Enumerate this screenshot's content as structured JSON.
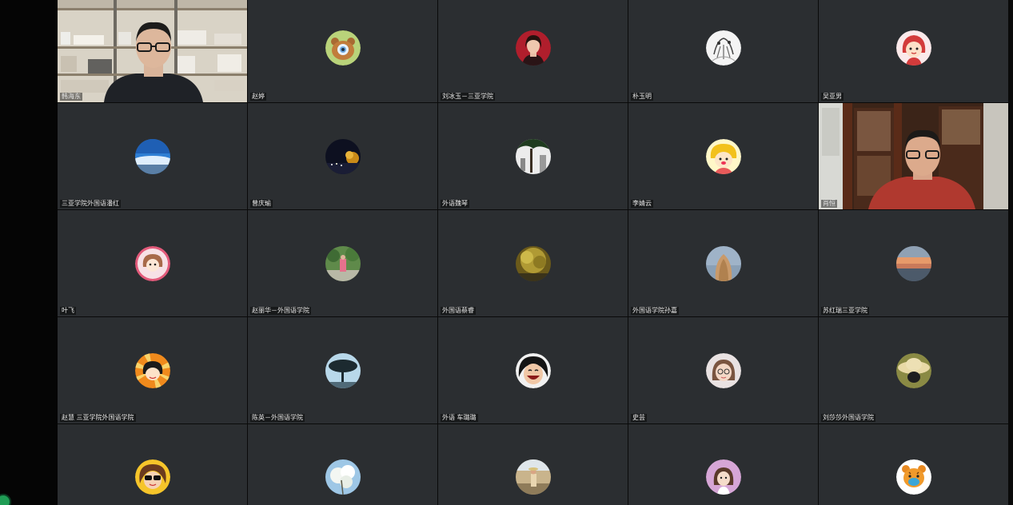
{
  "meeting": {
    "participants": [
      {
        "name": "韩海东",
        "avatar": "video-shelves"
      },
      {
        "name": "赵婷",
        "avatar": "bear-avatar"
      },
      {
        "name": "刘冰玉－三亚学院",
        "avatar": "woman-portrait-red"
      },
      {
        "name": "朴玉明",
        "avatar": "bw-sketch-avatar"
      },
      {
        "name": "吴亚男",
        "avatar": "cartoon-girl-red"
      },
      {
        "name": "三亚学院外国语潘红",
        "avatar": "sky-clouds-avatar"
      },
      {
        "name": "曾庆瑜",
        "avatar": "night-city-avatar"
      },
      {
        "name": "外语魏琴",
        "avatar": "tree-photo-avatar"
      },
      {
        "name": "李婧云",
        "avatar": "cartoon-yellow-avatar"
      },
      {
        "name": "肖恒",
        "avatar": "video-bookcase"
      },
      {
        "name": "叶飞",
        "avatar": "pink-doll-avatar"
      },
      {
        "name": "赵丽华－外国语学院",
        "avatar": "garden-person-avatar"
      },
      {
        "name": "外国语蔡睿",
        "avatar": "golden-tree-avatar"
      },
      {
        "name": "外国语学院孙嘉",
        "avatar": "long-hair-back-avatar"
      },
      {
        "name": "苏红瑞三亚学院",
        "avatar": "sunset-sea-avatar"
      },
      {
        "name": "赵慧 三亚学院外国语学院",
        "avatar": "cartoon-girl-sunburst"
      },
      {
        "name": "陈英－外国语学院",
        "avatar": "lone-tree-avatar"
      },
      {
        "name": "外语 车璐璐",
        "avatar": "laughing-face-avatar"
      },
      {
        "name": "史芸",
        "avatar": "girl-glasses-avatar"
      },
      {
        "name": "刘莎莎外国语学院",
        "avatar": "straw-hat-avatar"
      },
      {
        "name": "",
        "avatar": "sunglasses-cartoon-avatar"
      },
      {
        "name": "",
        "avatar": "white-blossom-avatar"
      },
      {
        "name": "",
        "avatar": "desert-person-avatar"
      },
      {
        "name": "",
        "avatar": "purple-cartoon-avatar"
      },
      {
        "name": "",
        "avatar": "tiger-cartoon-avatar"
      }
    ]
  },
  "colors": {
    "tile_bg": "#2b2e31",
    "active_speaker": "#3fbf58",
    "status": "#1f9d55"
  }
}
